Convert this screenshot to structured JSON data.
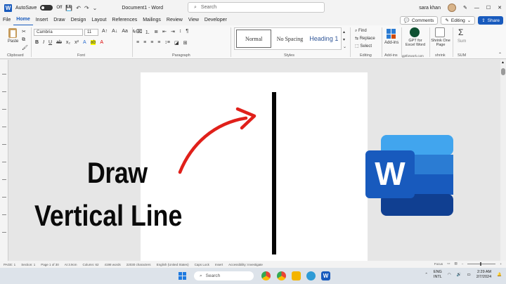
{
  "titlebar": {
    "autosave_label": "AutoSave",
    "autosave_state": "Off",
    "doc_title": "Document1 - Word",
    "search_placeholder": "Search",
    "user": "sara khan"
  },
  "menu": {
    "tabs": [
      "File",
      "Home",
      "Insert",
      "Draw",
      "Design",
      "Layout",
      "References",
      "Mailings",
      "Review",
      "View",
      "Developer"
    ],
    "active": "Home",
    "comments": "Comments",
    "editing": "Editing",
    "share": "Share"
  },
  "ribbon": {
    "paste": "Paste",
    "clipboard": "Clipboard",
    "font_name": "Cambria",
    "font_size": "11",
    "font_group": "Font",
    "paragraph_group": "Paragraph",
    "styles": [
      "Normal",
      "No Spacing",
      "Heading 1"
    ],
    "styles_group": "Styles",
    "find": "Find",
    "replace": "Replace",
    "select": "Select",
    "editing_group": "Editing",
    "addins": "Add-ins",
    "addins_group": "Add-ins",
    "gpt_label": "GPT for Excel Word",
    "gpt_group": "gptforwork.com",
    "shrink_label": "Shrink One Page",
    "shrink_group": "shrink",
    "sum_label": "Sum",
    "sum_group": "SUM"
  },
  "document": {
    "line1": "Draw",
    "line2": "Vertical Line"
  },
  "status": {
    "page": "PAGE: 1",
    "section": "Section: 1",
    "page_of": "Page 1 of 30",
    "at": "At 3.9cm",
    "column": "Column: 62",
    "words": "4198 words",
    "characters": "22030 characters",
    "language": "English (United States)",
    "caps": "Caps Lock",
    "insert": "Insert",
    "accessibility": "Accessibility: Investigate",
    "focus": "Focus"
  },
  "taskbar": {
    "search": "Search",
    "lang1": "ENG",
    "lang2": "INTL",
    "time": "2:29 AM",
    "date": "2/7/2024"
  },
  "colors": {
    "word_blue": "#185abd",
    "arrow_red": "#e0201a"
  }
}
